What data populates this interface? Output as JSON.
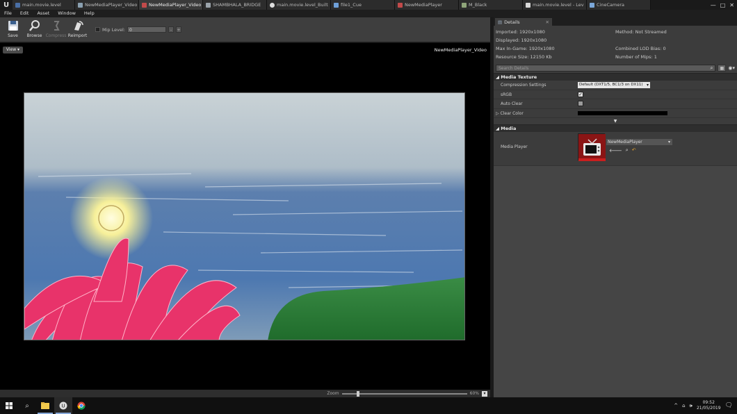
{
  "tabs": [
    {
      "label": "main.movie.level",
      "color": "#4a6fa5"
    },
    {
      "label": "NewMediaPlayer_Video",
      "color": "#8aa0b0"
    },
    {
      "label": "NewMediaPlayer_Video",
      "color": "#c24a4a"
    },
    {
      "label": "SHAMBHALA_BRIDGE",
      "color": "#9aa3aa"
    },
    {
      "label": "main.movie.level_Built",
      "color": "#dddddd"
    },
    {
      "label": "file1_Cue",
      "color": "#6fa0d8"
    },
    {
      "label": "NewMediaPlayer",
      "color": "#c24a4a"
    },
    {
      "label": "M_Black",
      "color": "#8fa57a"
    },
    {
      "label": "main.movie.level - Lev",
      "color": "#d8d8d8"
    },
    {
      "label": "CineCamera",
      "color": "#7ba7d8"
    }
  ],
  "window_controls": {
    "minimize": "—",
    "maximize": "□",
    "close": "✕"
  },
  "menu": [
    "File",
    "Edit",
    "Asset",
    "Window",
    "Help"
  ],
  "toolbar": {
    "save": "Save",
    "browse": "Browse",
    "compress": "Compress",
    "reimport": "Reimport",
    "mip_label": "Mip Level:",
    "mip_value": "0",
    "minus": "-",
    "plus": "+"
  },
  "viewport": {
    "view_button": "View ▾",
    "asset_name": "NewMediaPlayer_Video",
    "zoom_label": "Zoom",
    "zoom_value": "60%",
    "zoom_level": 0.12
  },
  "details": {
    "tab_label": "Details",
    "imported": "Imported: 1920x1080",
    "displayed": "Displayed: 1920x1080",
    "max_ingame": "Max In-Game: 1920x1080",
    "resource_size": "Resource Size: 12150 Kb",
    "method": "Method: Not Streamed",
    "lod_bias": "Combined LOD Bias: 0",
    "num_mips": "Number of Mips: 1",
    "search_placeholder": "Search Details",
    "media_texture_header": "◢ Media Texture",
    "compression_label": "Compression Settings",
    "compression_value": "Default (DXT1/5, BC1/3 on DX11)",
    "srgb_label": "sRGB",
    "srgb_checked": true,
    "auto_clear_label": "Auto Clear",
    "auto_clear_checked": false,
    "clear_color_label": "▷ Clear Color",
    "clear_color": "#000000",
    "media_header": "◢ Media",
    "media_player_label": "Media Player",
    "media_player_value": "NewMediaPlayer"
  },
  "taskbar": {
    "time": "09:52",
    "date": "21/05/2019"
  },
  "colors": {
    "accent": "#86a8d8",
    "lotus": "#e8336a",
    "water": "#3e6fa8"
  }
}
